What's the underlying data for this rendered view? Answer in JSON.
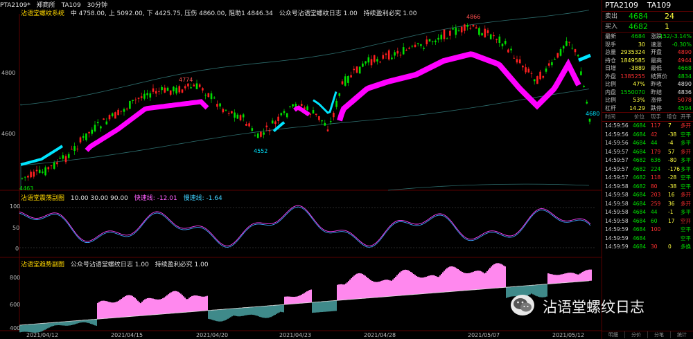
{
  "header": {
    "symbol": "PTA2109*",
    "exchange": "郑商所",
    "code": "TA109",
    "period": "30分钟",
    "indicator": "沾语堂螺纹系统",
    "stats": "中 4758.00, 上 5092.00, 下 4425.75, 压伤 4860.00, 阻助1 4846.34",
    "notice": "公众号沾语堂螺纹日志 1.00",
    "extra": "持续盈利必究 1.00"
  },
  "price_axis": {
    "labels": [
      "4800",
      "4600"
    ]
  },
  "annotations": {
    "high": "4866",
    "mid_high": "4774",
    "low": "4552",
    "last": "4680",
    "start": "4463"
  },
  "stoch_panel": {
    "label": "沾语堂震荡副图",
    "params": "10.00  30.00  90.00",
    "fast_label": "快速线: -12.01",
    "slow_label": "慢速线: -1.64",
    "axis": [
      "100",
      "50",
      "0"
    ]
  },
  "trend_panel": {
    "label": "沾语堂趋势副图",
    "notice": "公众号沾语堂螺纹日志 1.00",
    "extra": "持续盈利必究 1.00",
    "axis": [
      "800",
      "600",
      "400"
    ]
  },
  "dates": [
    "2021/04/12",
    "2021/04/15",
    "2021/04/20",
    "2021/04/23",
    "2021/04/28",
    "2021/05/07",
    "2021/05/12"
  ],
  "quote": {
    "symbol": "PTA2109",
    "code": "TA109",
    "ask_label": "卖出",
    "ask_price": "4684",
    "ask_vol": "24",
    "bid_label": "买入",
    "bid_price": "4682",
    "bid_vol": "1"
  },
  "stats": [
    {
      "l1": "最新",
      "v1": "4684",
      "c1": "green",
      "l2": "涨跌",
      "v2": "-152/-3.14%",
      "c2": "green"
    },
    {
      "l1": "现手",
      "v1": "30",
      "c1": "yellow",
      "l2": "速涨",
      "v2": "-0.30%",
      "c2": "green"
    },
    {
      "l1": "总量",
      "v1": "2935324",
      "c1": "yellow",
      "l2": "开盘",
      "v2": "4890",
      "c2": "red"
    },
    {
      "l1": "持仓",
      "v1": "1849585",
      "c1": "yellow",
      "l2": "最高",
      "v2": "4944",
      "c2": "red"
    },
    {
      "l1": "日增",
      "v1": "-3889",
      "c1": "yellow",
      "l2": "最低",
      "v2": "4668",
      "c2": "green"
    },
    {
      "l1": "外盘",
      "v1": "1385255",
      "c1": "red",
      "l2": "结算价",
      "v2": "4834",
      "c2": "green"
    },
    {
      "l1": "比例",
      "v1": "47%",
      "c1": "yellow",
      "l2": "昨收",
      "v2": "4890",
      "c2": "white"
    },
    {
      "l1": "内盘",
      "v1": "1550070",
      "c1": "green",
      "l2": "昨结",
      "v2": "4836",
      "c2": "white"
    },
    {
      "l1": "比例",
      "v1": "53%",
      "c1": "yellow",
      "l2": "涨停",
      "v2": "5078",
      "c2": "red"
    },
    {
      "l1": "杠杆",
      "v1": "14.29",
      "c1": "yellow",
      "l2": "跌停",
      "v2": "4594",
      "c2": "green"
    }
  ],
  "tick_headers": [
    "时间",
    "价位",
    "现手",
    "增仓",
    "开平"
  ],
  "ticks": [
    {
      "t": "14:59:56",
      "p": "4684",
      "v": "117",
      "d": "7",
      "k": "多开",
      "vc": "red",
      "dc": "yellow"
    },
    {
      "t": "14:59:56",
      "p": "4684",
      "v": "42",
      "d": "-38",
      "k": "空平",
      "vc": "red",
      "dc": "yellow"
    },
    {
      "t": "14:59:56",
      "p": "4684",
      "v": "44",
      "d": "-4",
      "k": "多平",
      "vc": "green",
      "dc": "yellow"
    },
    {
      "t": "14:59:57",
      "p": "4684",
      "v": "179",
      "d": "57",
      "k": "多开",
      "vc": "red",
      "dc": "yellow"
    },
    {
      "t": "14:59:57",
      "p": "4682",
      "v": "636",
      "d": "-80",
      "k": "多平",
      "vc": "green",
      "dc": "yellow"
    },
    {
      "t": "14:59:57",
      "p": "4682",
      "v": "224",
      "d": "-176",
      "k": "多平",
      "vc": "green",
      "dc": "yellow"
    },
    {
      "t": "14:59:57",
      "p": "4682",
      "v": "118",
      "d": "-28",
      "k": "空平",
      "vc": "red",
      "dc": "yellow"
    },
    {
      "t": "14:59:58",
      "p": "4682",
      "v": "80",
      "d": "-38",
      "k": "空平",
      "vc": "red",
      "dc": "yellow"
    },
    {
      "t": "14:59:58",
      "p": "4684",
      "v": "203",
      "d": "16",
      "k": "多开",
      "vc": "red",
      "dc": "yellow"
    },
    {
      "t": "14:59:58",
      "p": "4684",
      "v": "259",
      "d": "36",
      "k": "多开",
      "vc": "red",
      "dc": "yellow"
    },
    {
      "t": "14:59:58",
      "p": "4684",
      "v": "44",
      "d": "-1",
      "k": "多平",
      "vc": "green",
      "dc": "yellow"
    },
    {
      "t": "14:59:58",
      "p": "4684",
      "v": "60",
      "d": "17",
      "k": "空开",
      "vc": "green",
      "dc": "yellow"
    },
    {
      "t": "14:59:59",
      "p": "4684",
      "v": "100",
      "d": "",
      "k": "空平",
      "vc": "red",
      "dc": "yellow"
    },
    {
      "t": "14:59:59",
      "p": "4684",
      "v": "",
      "d": "",
      "k": "空平",
      "vc": "red",
      "dc": "yellow"
    },
    {
      "t": "14:59:59",
      "p": "4684",
      "v": "30",
      "d": "0",
      "k": "多换",
      "vc": "red",
      "dc": "yellow"
    }
  ],
  "bottom_tabs": [
    "明细",
    "分价",
    "分笔",
    "统计"
  ],
  "watermark": {
    "text": "沾语堂螺纹日志"
  },
  "colors": {
    "up": "#ff2020",
    "down": "#00e000",
    "ma": "#ff00ff",
    "ma_alt": "#00e5ff",
    "border": "#5a0000"
  }
}
